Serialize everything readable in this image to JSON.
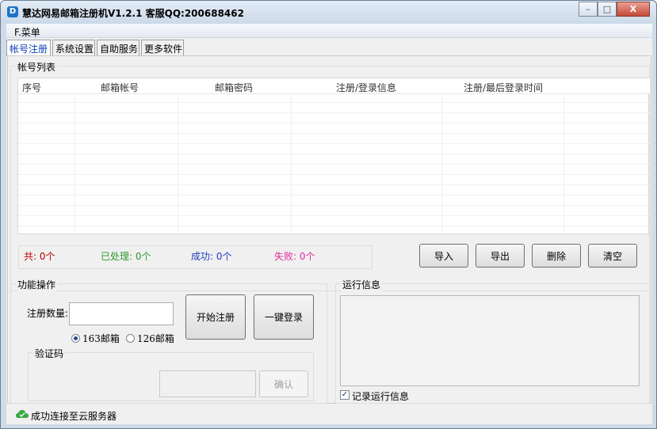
{
  "window": {
    "title": "慧达网易邮箱注册机V1.2.1 客服QQ:200688462",
    "controls": {
      "minimize": "–",
      "maximize": "□",
      "close": "X"
    }
  },
  "menu": {
    "file": "F.菜单"
  },
  "tabs": [
    "帐号注册",
    "系统设置",
    "自助服务",
    "更多软件"
  ],
  "account_list": {
    "title": "帐号列表",
    "columns": [
      "序号",
      "邮箱帐号",
      "邮箱密码",
      "注册/登录信息",
      "注册/最后登录时间"
    ],
    "rows": []
  },
  "stats": {
    "total": "共: 0个",
    "processed": "已处理: 0个",
    "success": "成功: 0个",
    "failed": "失败: 0个",
    "colors": {
      "total": "#c00000",
      "processed": "#2e9a2e",
      "success": "#1f3fbf",
      "failed": "#e02c9c"
    }
  },
  "actions": {
    "import": "导入",
    "export": "导出",
    "delete": "删除",
    "clear": "清空"
  },
  "function_panel": {
    "title": "功能操作",
    "register_count_label": "注册数量:",
    "register_count_value": "",
    "start_button": "开始注册",
    "login_button": "一键登录",
    "mail_options": [
      {
        "label": "163邮箱",
        "selected": true
      },
      {
        "label": "126邮箱",
        "selected": false
      }
    ],
    "captcha": {
      "title": "验证码",
      "input_value": "",
      "confirm_button": "确认"
    }
  },
  "log_panel": {
    "title": "运行信息",
    "record_checkbox_label": "记录运行信息",
    "record_checked": true
  },
  "status": {
    "text": "成功连接至云服务器",
    "icon": "cloud-icon"
  }
}
